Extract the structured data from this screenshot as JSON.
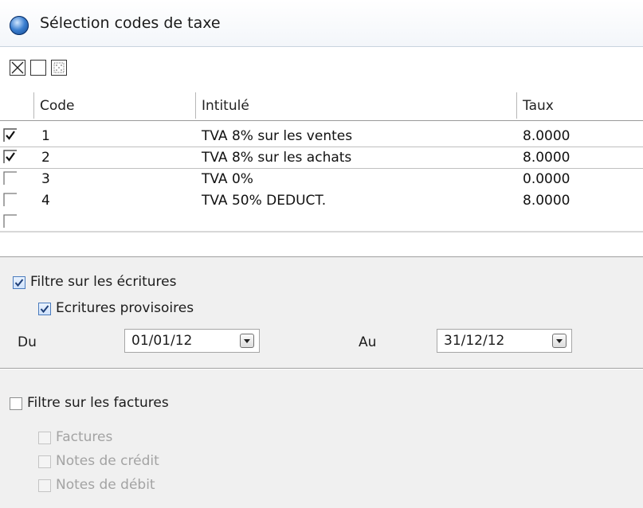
{
  "window": {
    "title": "Sélection codes de taxe"
  },
  "toolbar": {
    "buttons": [
      {
        "name": "select-all",
        "icon": "x-box-icon"
      },
      {
        "name": "select-none",
        "icon": "empty-box-icon"
      },
      {
        "name": "invert-selection",
        "icon": "dotted-box-icon"
      }
    ]
  },
  "grid": {
    "columns": [
      "Code",
      "Intitulé",
      "Taux"
    ],
    "rows": [
      {
        "checked": true,
        "code": "1",
        "label": "TVA 8% sur les ventes",
        "rate": "8.0000"
      },
      {
        "checked": true,
        "code": "2",
        "label": "TVA 8% sur les achats",
        "rate": "8.0000"
      },
      {
        "checked": false,
        "code": "3",
        "label": "TVA 0%",
        "rate": "0.0000"
      },
      {
        "checked": false,
        "code": "4",
        "label": "TVA 50% DEDUCT.",
        "rate": "8.0000"
      }
    ]
  },
  "filters": {
    "entries": {
      "label": "Filtre sur les écritures",
      "checked": true,
      "provisional_label": "Ecritures provisoires",
      "provisional_checked": true,
      "from_label": "Du",
      "from_value": "01/01/12",
      "to_label": "Au",
      "to_value": "31/12/12"
    },
    "invoices": {
      "label": "Filtre sur les factures",
      "checked": false,
      "options": [
        {
          "label": "Factures",
          "checked": false,
          "enabled": false
        },
        {
          "label": "Notes de crédit",
          "checked": false,
          "enabled": false
        },
        {
          "label": "Notes de débit",
          "checked": false,
          "enabled": false
        }
      ]
    }
  },
  "colors": {
    "accent": "#4a7bbd",
    "panel_bg": "#f0f0f0",
    "disabled_text": "#a3a3a3"
  }
}
